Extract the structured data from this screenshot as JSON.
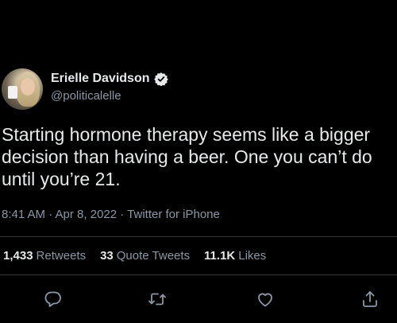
{
  "author": {
    "name": "Erielle Davidson",
    "handle": "@politicalelle",
    "verified_color": "#e7e9ea"
  },
  "tweet": {
    "text": "Starting hormone therapy seems like a bigger decision than having a beer. One you can’t do until you’re 21.",
    "time": "8:41 AM",
    "date": "Apr 8, 2022",
    "source": "Twitter for iPhone",
    "meta_line": "8:41 AM · Apr 8, 2022 · Twitter for iPhone"
  },
  "stats": {
    "retweets_count": "1,433",
    "retweets_label": "Retweets",
    "quotes_count": "33",
    "quotes_label": "Quote Tweets",
    "likes_count": "11.1K",
    "likes_label": "Likes"
  },
  "actions": [
    {
      "icon": "reply-icon"
    },
    {
      "icon": "retweet-icon"
    },
    {
      "icon": "like-icon"
    },
    {
      "icon": "share-icon"
    }
  ],
  "colors": {
    "background": "#000000",
    "primary_text": "#e7e9ea",
    "secondary_text": "#8b98a5",
    "divider": "#2f3336"
  }
}
